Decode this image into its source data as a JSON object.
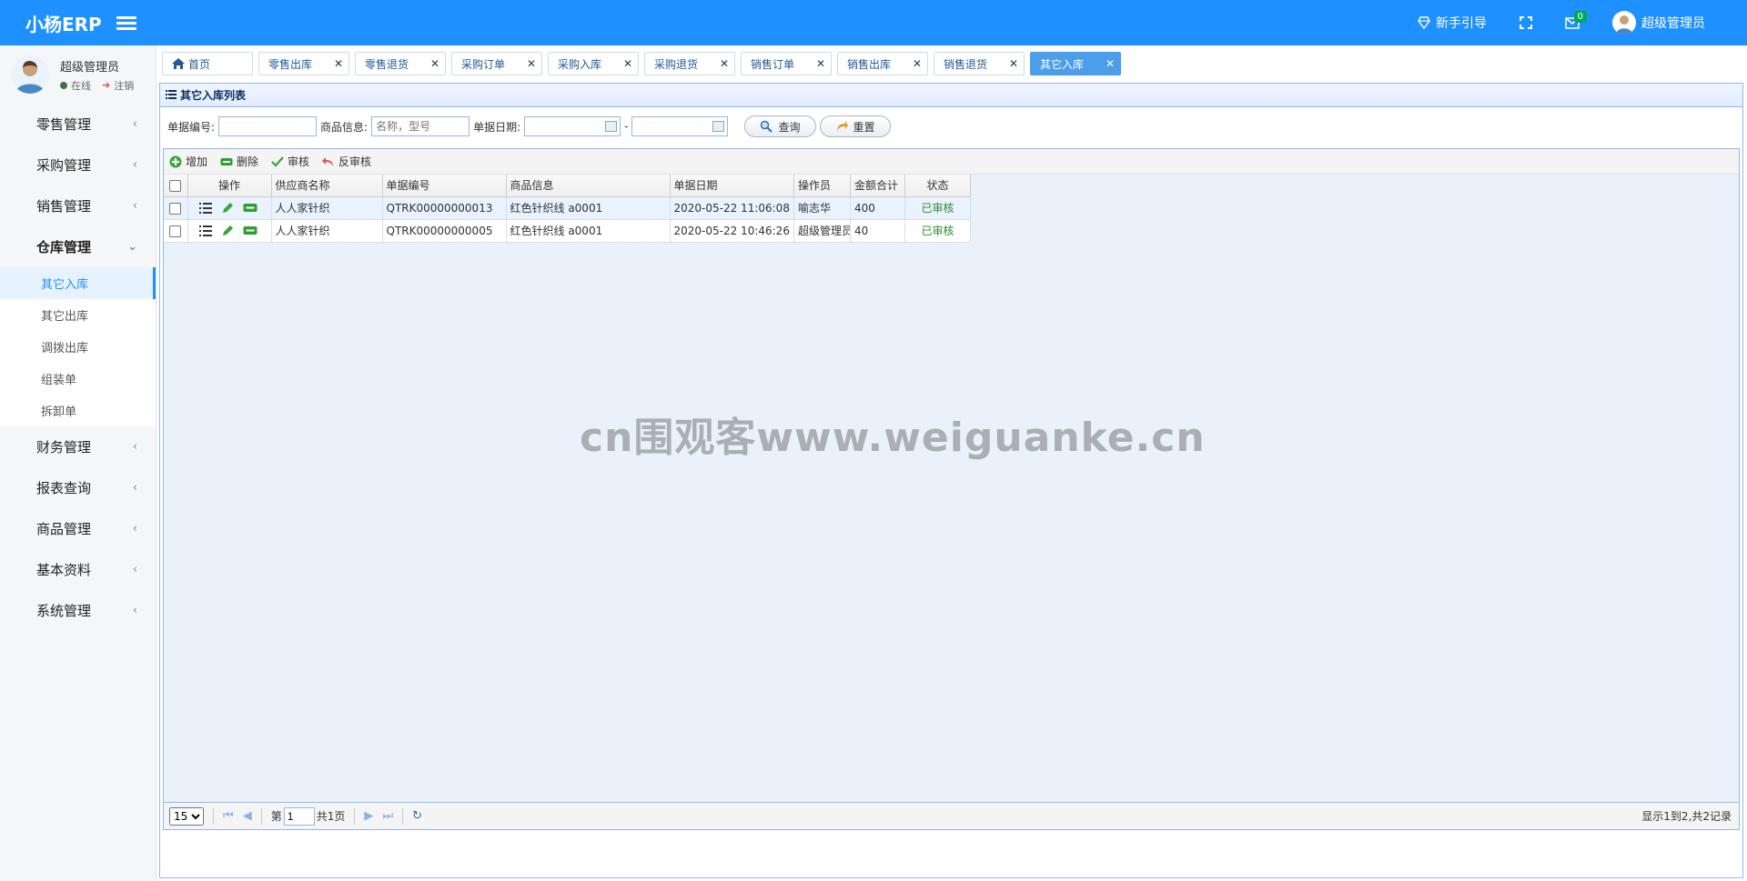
{
  "header": {
    "logo": "小杨ERP",
    "guide_label": "新手引导",
    "mail_badge": "0",
    "user_name": "超级管理员"
  },
  "sidebar": {
    "user_name": "超级管理员",
    "status_online": "在线",
    "logout_label": "注销",
    "groups": [
      {
        "label": "零售管理"
      },
      {
        "label": "采购管理"
      },
      {
        "label": "销售管理"
      },
      {
        "label": "仓库管理"
      },
      {
        "label": "财务管理"
      },
      {
        "label": "报表查询"
      },
      {
        "label": "商品管理"
      },
      {
        "label": "基本资料"
      },
      {
        "label": "系统管理"
      }
    ],
    "warehouse_items": [
      "其它入库",
      "其它出库",
      "调拨出库",
      "组装单",
      "拆卸单"
    ]
  },
  "tabs": [
    {
      "label": "首页"
    },
    {
      "label": "零售出库"
    },
    {
      "label": "零售退货"
    },
    {
      "label": "采购订单"
    },
    {
      "label": "采购入库"
    },
    {
      "label": "采购退货"
    },
    {
      "label": "销售订单"
    },
    {
      "label": "销售出库"
    },
    {
      "label": "销售退货"
    },
    {
      "label": "其它入库"
    }
  ],
  "panel": {
    "title": "其它入库列表",
    "search": {
      "number_label": "单据编号:",
      "number_value": "",
      "goods_label": "商品信息:",
      "goods_placeholder": "名称，型号",
      "date_label": "单据日期:",
      "date_sep": "-",
      "query_label": "查询",
      "reset_label": "重置"
    },
    "toolbar": {
      "add": "增加",
      "delete": "删除",
      "audit": "审核",
      "unaudit": "反审核"
    },
    "columns": [
      "操作",
      "供应商名称",
      "单据编号",
      "商品信息",
      "单据日期",
      "操作员",
      "金额合计",
      "状态"
    ],
    "rows": [
      {
        "supplier": "人人家针织",
        "number": "QTRK00000000013",
        "goods": "红色针织线 a0001",
        "date": "2020-05-22 11:06:08",
        "operator": "喻志华",
        "amount": "400",
        "status": "已审核"
      },
      {
        "supplier": "人人家针织",
        "number": "QTRK00000000005",
        "goods": "红色针织线 a0001",
        "date": "2020-05-22 10:46:26",
        "operator": "超级管理员",
        "amount": "40",
        "status": "已审核"
      }
    ],
    "pager": {
      "page_size": "15",
      "page_prefix": "第",
      "page_value": "1",
      "page_total": "共1页",
      "info": "显示1到2,共2记录"
    }
  },
  "watermark": "cn围观客www.weiguanke.cn",
  "colors": {
    "primary": "#1e90ff",
    "panel_border": "#95b8e7",
    "ok": "#2e8b2e"
  }
}
